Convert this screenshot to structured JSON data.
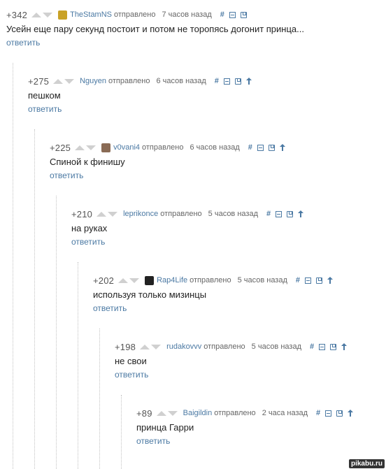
{
  "comments": [
    {
      "rating": "+342",
      "author": "TheStamNS",
      "sent": "отправлено",
      "time": "7 часов назад",
      "text": "Усейн еще пару секунд постоит и потом не торопясь догонит принца...",
      "reply": "ответить",
      "avatar_icon": "user-avatar-icon",
      "avatar_color": "#c9a227",
      "tools": [
        "link-hash-icon",
        "collapse-icon",
        "save-icon"
      ]
    },
    {
      "rating": "+275",
      "author": "Nguyen",
      "sent": "отправлено",
      "time": "6 часов назад",
      "text": "пешком",
      "reply": "ответить",
      "tools": [
        "link-hash-icon",
        "collapse-icon",
        "save-icon",
        "parent-arrow-icon"
      ]
    },
    {
      "rating": "+225",
      "author": "v0vani4",
      "sent": "отправлено",
      "time": "6 часов назад",
      "text": "Спиной к финишу",
      "reply": "ответить",
      "avatar_icon": "user-avatar-icon",
      "avatar_color": "#8a6b55",
      "tools": [
        "link-hash-icon",
        "collapse-icon",
        "save-icon",
        "parent-arrow-icon"
      ]
    },
    {
      "rating": "+210",
      "author": "leprikonce",
      "sent": "отправлено",
      "time": "5 часов назад",
      "text": "на руках",
      "reply": "ответить",
      "tools": [
        "link-hash-icon",
        "collapse-icon",
        "save-icon",
        "parent-arrow-icon"
      ]
    },
    {
      "rating": "+202",
      "author": "Rap4Life",
      "sent": "отправлено",
      "time": "5 часов назад",
      "text": "используя только мизинцы",
      "reply": "ответить",
      "avatar_icon": "user-avatar-icon",
      "avatar_color": "#222222",
      "tools": [
        "link-hash-icon",
        "collapse-icon",
        "save-icon",
        "parent-arrow-icon"
      ]
    },
    {
      "rating": "+198",
      "author": "rudakovvv",
      "sent": "отправлено",
      "time": "5 часов назад",
      "text": "не свои",
      "reply": "ответить",
      "tools": [
        "link-hash-icon",
        "collapse-icon",
        "save-icon",
        "parent-arrow-icon"
      ]
    },
    {
      "rating": "+89",
      "author": "Baigildin",
      "sent": "отправлено",
      "time": "2 часа назад",
      "text": "принца Гарри",
      "reply": "ответить",
      "tools": [
        "link-hash-icon",
        "collapse-icon",
        "save-icon",
        "parent-arrow-icon"
      ]
    }
  ],
  "watermark": "pikabu.ru",
  "colors": {
    "link": "#4b79a3",
    "vote_arrow": "#d0d0d0",
    "rail": "#c2c2c2"
  }
}
